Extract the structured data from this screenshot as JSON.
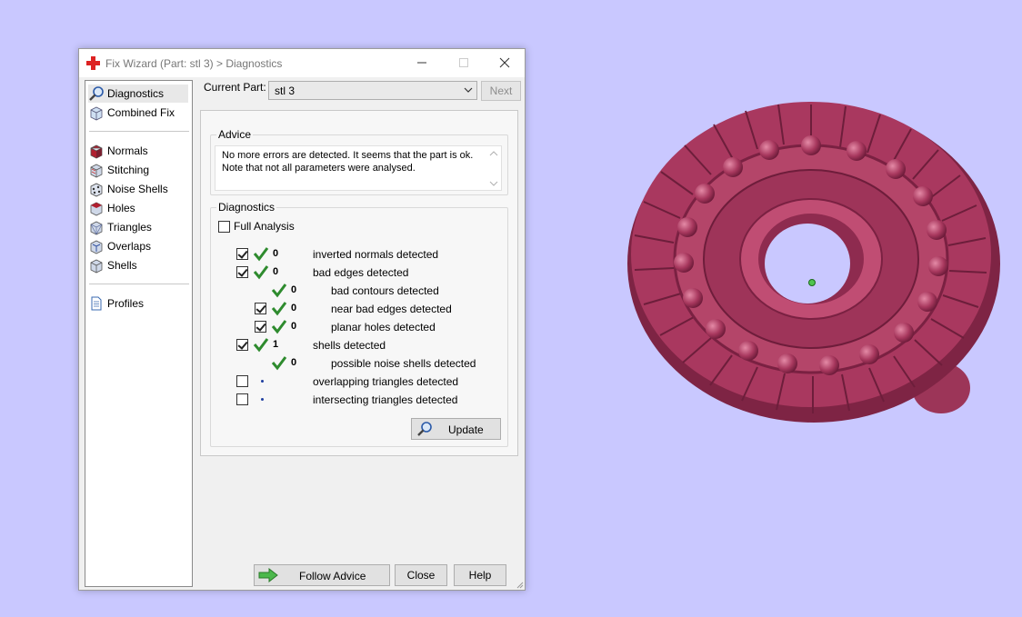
{
  "window": {
    "title": "Fix Wizard (Part: stl 3) > Diagnostics",
    "minimize_icon": "minimize-icon",
    "maximize_icon": "maximize-icon",
    "close_icon": "close-icon"
  },
  "sidebar": {
    "items": [
      {
        "label": "Diagnostics",
        "icon": "magnifier-icon",
        "selected": true
      },
      {
        "label": "Combined Fix",
        "icon": "cube-icon"
      },
      {
        "label": "Normals",
        "icon": "normals-cube-icon"
      },
      {
        "label": "Stitching",
        "icon": "stitching-cube-icon"
      },
      {
        "label": "Noise Shells",
        "icon": "noise-shells-icon"
      },
      {
        "label": "Holes",
        "icon": "holes-cube-icon"
      },
      {
        "label": "Triangles",
        "icon": "triangles-cube-icon"
      },
      {
        "label": "Overlaps",
        "icon": "overlaps-cube-icon"
      },
      {
        "label": "Shells",
        "icon": "shells-cube-icon"
      },
      {
        "label": "Profiles",
        "icon": "document-icon"
      }
    ]
  },
  "current_part": {
    "label": "Current Part:",
    "value": "stl 3",
    "next_label": "Next"
  },
  "advice": {
    "title": "Advice",
    "line1": "No more errors are detected. It seems that the part is ok.",
    "line2": "Note that not all parameters were analysed."
  },
  "diagnostics": {
    "title": "Diagnostics",
    "full_analysis_label": "Full Analysis",
    "full_analysis_checked": false,
    "rows": [
      {
        "label": "inverted normals detected",
        "count": "0",
        "checked": true,
        "status": "ok"
      },
      {
        "label": "bad edges detected",
        "count": "0",
        "checked": true,
        "status": "ok"
      },
      {
        "label": "bad contours detected",
        "count": "0",
        "status": "ok"
      },
      {
        "label": "near bad edges detected",
        "count": "0",
        "checked": true,
        "status": "ok"
      },
      {
        "label": "planar holes detected",
        "count": "0",
        "checked": true,
        "status": "ok"
      },
      {
        "label": "shells detected",
        "count": "1",
        "checked": true,
        "status": "ok"
      },
      {
        "label": "possible noise shells detected",
        "count": "0",
        "status": "ok"
      },
      {
        "label": "overlapping triangles detected",
        "count": "",
        "checked": false,
        "status": "pending"
      },
      {
        "label": "intersecting triangles detected",
        "count": "",
        "checked": false,
        "status": "pending"
      }
    ],
    "update_label": "Update"
  },
  "footer": {
    "follow_advice_label": "Follow Advice",
    "close_label": "Close",
    "help_label": "Help"
  },
  "colors": {
    "background": "#c9c8ff",
    "model": "#a03a5a",
    "check_green": "#2e8b2e"
  }
}
